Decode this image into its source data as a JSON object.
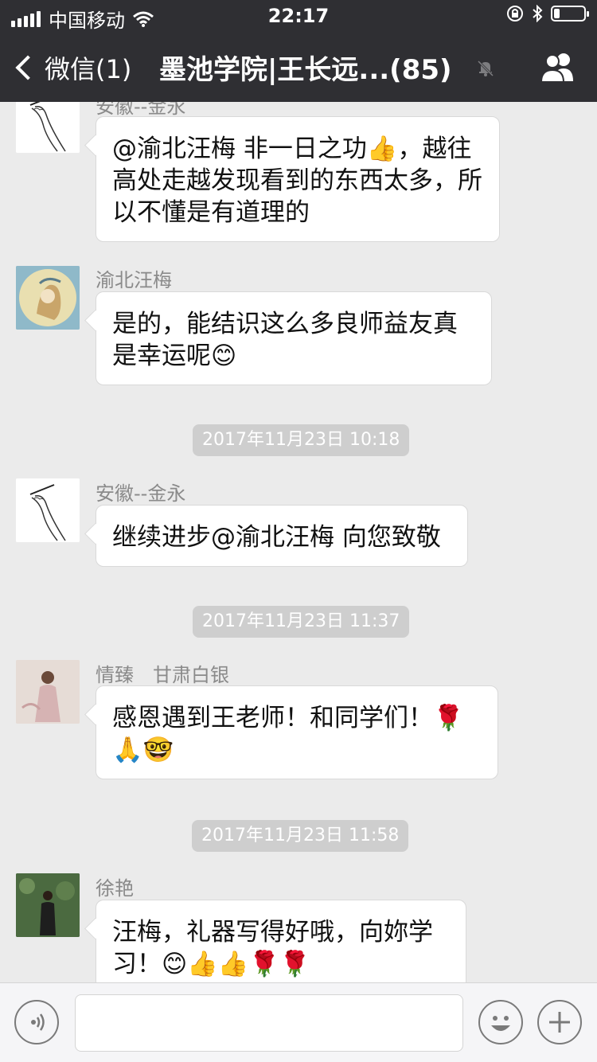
{
  "status_bar": {
    "carrier": "中国移动",
    "time": "22:17",
    "battery_level": 0.2
  },
  "nav": {
    "back_label": "微信(1)",
    "title": "墨池学院|王长远...(85)"
  },
  "messages": [
    {
      "type": "message",
      "sender": "安徽--金永",
      "text": "@渝北汪梅 非一日之功👍，越往高处走越发现看到的东西太多，所以不懂是有道理的"
    },
    {
      "type": "message",
      "sender": "渝北汪梅",
      "text": "是的，能结识这么多良师益友真是幸运呢😊"
    },
    {
      "type": "timestamp",
      "text": "2017年11月23日 10:18"
    },
    {
      "type": "message",
      "sender": "安徽--金永",
      "text": "继续进步@渝北汪梅 向您致敬"
    },
    {
      "type": "timestamp",
      "text": "2017年11月23日 11:37"
    },
    {
      "type": "message",
      "sender": "情臻　甘肃白银",
      "text": "感恩遇到王老师！和同学们！🌹🙏🤓"
    },
    {
      "type": "timestamp",
      "text": "2017年11月23日 11:58"
    },
    {
      "type": "message",
      "sender": "徐艳",
      "text": "汪梅，礼器写得好哦，向妳学习！😊👍👍🌹🌹"
    }
  ],
  "icons": {
    "back": "chevron-left-icon",
    "mute": "bell-muted-icon",
    "group": "group-members-icon",
    "voice": "voice-input-icon",
    "emoji": "emoji-icon",
    "more": "plus-icon"
  },
  "colors": {
    "nav_bg": "#2f2f33",
    "chat_bg": "#ebebeb",
    "bubble_bg": "#ffffff",
    "timestamp_bg": "#cecece"
  }
}
